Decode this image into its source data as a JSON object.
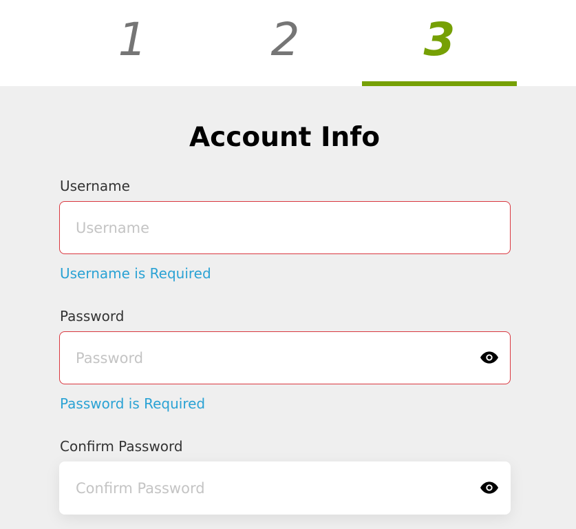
{
  "stepper": {
    "steps": [
      {
        "label": "1"
      },
      {
        "label": "2"
      },
      {
        "label": "3"
      }
    ],
    "active_step": 3,
    "accent_color": "#76a005"
  },
  "form": {
    "title": "Account Info",
    "username": {
      "label": "Username",
      "placeholder": "Username",
      "value": "",
      "error": "Username is Required"
    },
    "password": {
      "label": "Password",
      "placeholder": "Password",
      "value": "",
      "error": "Password is Required",
      "toggle_icon": "eye-icon"
    },
    "confirm_password": {
      "label": "Confirm Password",
      "placeholder": "Confirm Password",
      "value": "",
      "toggle_icon": "eye-icon"
    },
    "error_border_color": "#d9363e",
    "error_text_color": "#2aa2d4"
  }
}
